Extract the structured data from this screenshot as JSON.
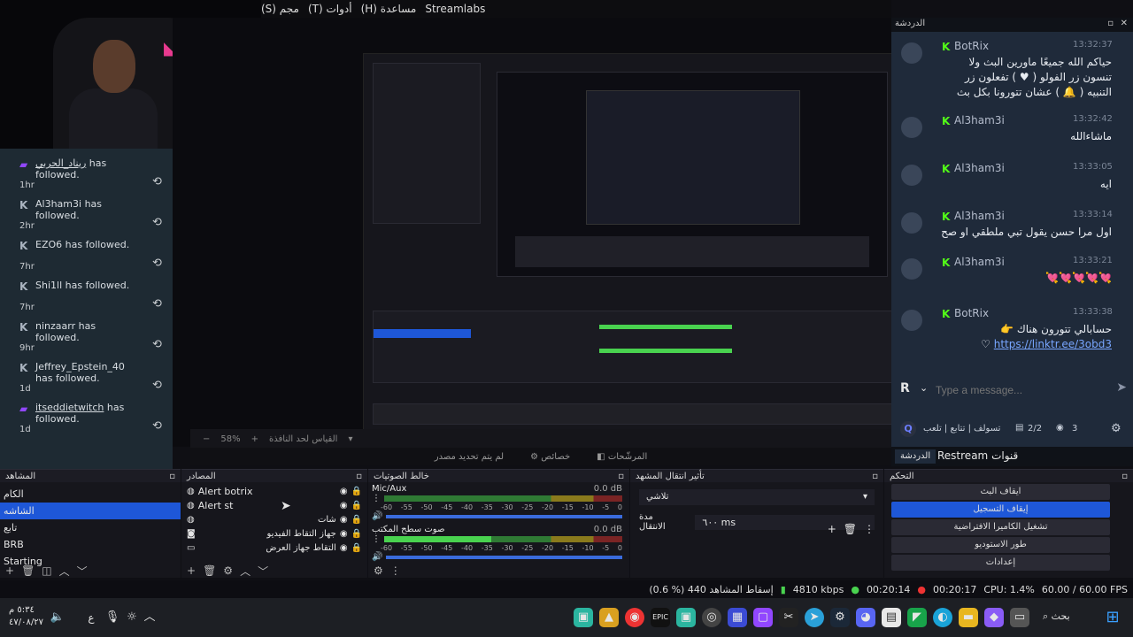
{
  "menu": {
    "items": [
      "(S) مجم",
      "(T) أدوات",
      "(H) مساعدة",
      "Streamlabs"
    ]
  },
  "follows": [
    {
      "name": "ريناد_الحربي",
      "action": "has followed.",
      "time": "1hr",
      "platform": "twitch"
    },
    {
      "name": "Al3ham3i",
      "action": "has followed.",
      "time": "2hr",
      "platform": "kick"
    },
    {
      "name": "EZO6",
      "action": "has followed.",
      "time": "7hr",
      "platform": "kick"
    },
    {
      "name": "Shi1ll",
      "action": "has followed.",
      "time": "7hr",
      "platform": "kick"
    },
    {
      "name": "ninzaarr",
      "action": "has followed.",
      "time": "9hr",
      "platform": "kick"
    },
    {
      "name": "Jeffrey_Epstein_40",
      "action": "has followed.",
      "time": "1d",
      "platform": "kick"
    },
    {
      "name": "itseddietwitch",
      "action": "has followed.",
      "time": "1d",
      "platform": "twitch"
    }
  ],
  "preview": {
    "zoom": "58%",
    "scale_label": "القياس لحد النافذة",
    "tabs": [
      "لم يتم تحديد مصدر",
      "خصائص",
      "المرشّحات"
    ]
  },
  "chat": {
    "title": "الدردشة",
    "messages": [
      {
        "user": "BotRix",
        "time": "13:32:37",
        "body": "حياكم الله جميعًا ماورين البث ولا تنسون زر الفولو ( ♥ ) تفعلون زر التنبيه ( 🔔 ) عشان تتورونا بكل بث",
        "dir": "rtl"
      },
      {
        "user": "Al3ham3i",
        "time": "13:32:42",
        "body": "ماشاءالله",
        "dir": "rtl"
      },
      {
        "user": "Al3ham3i",
        "time": "13:33:05",
        "body": "ايه",
        "dir": "rtl"
      },
      {
        "user": "Al3ham3i",
        "time": "13:33:14",
        "body": "اول مرا حسن يقول تبي ملطقي او صح",
        "dir": "rtl"
      },
      {
        "user": "Al3ham3i",
        "time": "13:33:21",
        "body": "💘💘💘💘💘",
        "dir": "rtl"
      },
      {
        "user": "BotRix",
        "time": "13:33:38",
        "body": "حسابالي تتورون هناك 👉",
        "link": "https://linktr.ee/3obd3",
        "dir": "rtl"
      }
    ],
    "input_placeholder": "Type a message...",
    "footer_text": "تسولف | تتابع | تلعب",
    "viewers_ratio": "2/2",
    "viewers": "3",
    "tabs": [
      "الدردشة",
      "Restream قنوات"
    ]
  },
  "docks": {
    "scenes": {
      "title": "المشاهد",
      "items": [
        "الكام",
        "الشاشه",
        "تابع",
        "BRB",
        "Starting"
      ],
      "selected_index": 1
    },
    "sources": {
      "title": "المصادر",
      "items": [
        "Alert botrix",
        "Alert st",
        "شات",
        "جهاز التقاط الفيديو",
        "التقاط جهاز العرض"
      ]
    },
    "mixer": {
      "title": "خالط الصوتيات",
      "channels": [
        {
          "name": "Mic/Aux",
          "db": "0.0 dB"
        },
        {
          "name": "صوت سطح المكتب",
          "db": "0.0 dB"
        }
      ],
      "scale": [
        "-60",
        "-55",
        "-50",
        "-45",
        "-40",
        "-35",
        "-30",
        "-25",
        "-20",
        "-15",
        "-10",
        "-5",
        "0"
      ]
    },
    "transitions": {
      "title": "تأثير انتقال المشهد",
      "type": "تلاشي",
      "duration_label": "مدة الانتقال",
      "duration_value": "٦٠٠ ms"
    },
    "controls": {
      "title": "التحكم",
      "buttons": [
        "ايقاف البث",
        "إيقاف التسجيل",
        "تشغيل الكاميرا الافتراضية",
        "طور الاستوديو",
        "إعدادات"
      ],
      "active_index": 1
    }
  },
  "status": {
    "dropped": "(0.6 %) 440 إسقاط المشاهد",
    "bitrate": "4810 kbps",
    "live_time": "00:20:14",
    "rec_time": "00:20:17",
    "cpu": "CPU: 1.4%",
    "fps": "60.00 / 60.00 FPS"
  },
  "taskbar": {
    "time": "٥:٣٤ م",
    "date": "٤٧/٠٨/٢٧",
    "lang": "ع",
    "search": "بحث"
  },
  "colors": {
    "accent": "#1e57d8",
    "kick": "#53fc18",
    "twitch": "#9147ff",
    "chat_bg": "#1f2a3a",
    "follows_bg": "#1e2a33"
  }
}
